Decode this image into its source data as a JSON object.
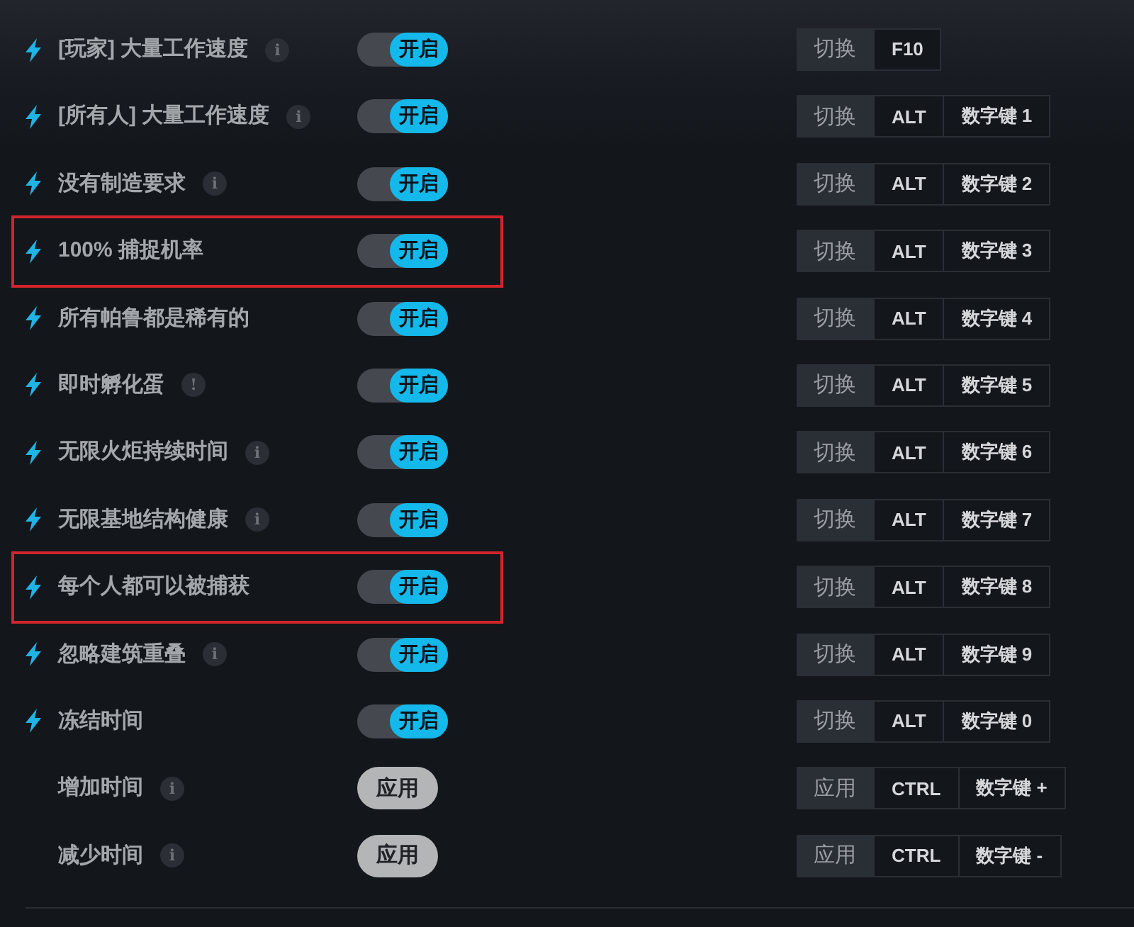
{
  "rows": [
    {
      "kind": "toggle",
      "label": "[玩家] 大量工作速度",
      "hint": "i",
      "highlighted": false,
      "control": {
        "text": "开启",
        "on": true
      },
      "hotkey": {
        "action": "切换",
        "keys": [
          "F10"
        ]
      }
    },
    {
      "kind": "toggle",
      "label": "[所有人] 大量工作速度",
      "hint": "i",
      "highlighted": false,
      "control": {
        "text": "开启",
        "on": true
      },
      "hotkey": {
        "action": "切换",
        "keys": [
          "ALT",
          "数字键 1"
        ]
      }
    },
    {
      "kind": "toggle",
      "label": "没有制造要求",
      "hint": "i",
      "highlighted": false,
      "control": {
        "text": "开启",
        "on": true
      },
      "hotkey": {
        "action": "切换",
        "keys": [
          "ALT",
          "数字键 2"
        ]
      }
    },
    {
      "kind": "toggle",
      "label": "100% 捕捉机率",
      "highlighted": true,
      "control": {
        "text": "开启",
        "on": true
      },
      "hotkey": {
        "action": "切换",
        "keys": [
          "ALT",
          "数字键 3"
        ]
      }
    },
    {
      "kind": "toggle",
      "label": "所有帕鲁都是稀有的",
      "highlighted": false,
      "control": {
        "text": "开启",
        "on": true
      },
      "hotkey": {
        "action": "切换",
        "keys": [
          "ALT",
          "数字键 4"
        ]
      }
    },
    {
      "kind": "toggle",
      "label": "即时孵化蛋",
      "hint": "!",
      "highlighted": false,
      "control": {
        "text": "开启",
        "on": true
      },
      "hotkey": {
        "action": "切换",
        "keys": [
          "ALT",
          "数字键 5"
        ]
      }
    },
    {
      "kind": "toggle",
      "label": "无限火炬持续时间",
      "hint": "i",
      "highlighted": false,
      "control": {
        "text": "开启",
        "on": true
      },
      "hotkey": {
        "action": "切换",
        "keys": [
          "ALT",
          "数字键 6"
        ]
      }
    },
    {
      "kind": "toggle",
      "label": "无限基地结构健康",
      "hint": "i",
      "highlighted": false,
      "control": {
        "text": "开启",
        "on": true
      },
      "hotkey": {
        "action": "切换",
        "keys": [
          "ALT",
          "数字键 7"
        ]
      }
    },
    {
      "kind": "toggle",
      "label": "每个人都可以被捕获",
      "highlighted": true,
      "control": {
        "text": "开启",
        "on": true
      },
      "hotkey": {
        "action": "切换",
        "keys": [
          "ALT",
          "数字键 8"
        ]
      }
    },
    {
      "kind": "toggle",
      "label": "忽略建筑重叠",
      "hint": "i",
      "highlighted": false,
      "control": {
        "text": "开启",
        "on": true
      },
      "hotkey": {
        "action": "切换",
        "keys": [
          "ALT",
          "数字键 9"
        ]
      }
    },
    {
      "kind": "toggle",
      "label": "冻结时间",
      "highlighted": false,
      "control": {
        "text": "开启",
        "on": true
      },
      "hotkey": {
        "action": "切换",
        "keys": [
          "ALT",
          "数字键 0"
        ]
      }
    },
    {
      "kind": "apply",
      "label": "增加时间",
      "hint": "i",
      "highlighted": false,
      "control": {
        "text": "应用"
      },
      "hotkey": {
        "action": "应用",
        "keys": [
          "CTRL",
          "数字键 +"
        ]
      }
    },
    {
      "kind": "apply",
      "label": "减少时间",
      "hint": "i",
      "highlighted": false,
      "control": {
        "text": "应用"
      },
      "hotkey": {
        "action": "应用",
        "keys": [
          "CTRL",
          "数字键 -"
        ]
      }
    }
  ]
}
